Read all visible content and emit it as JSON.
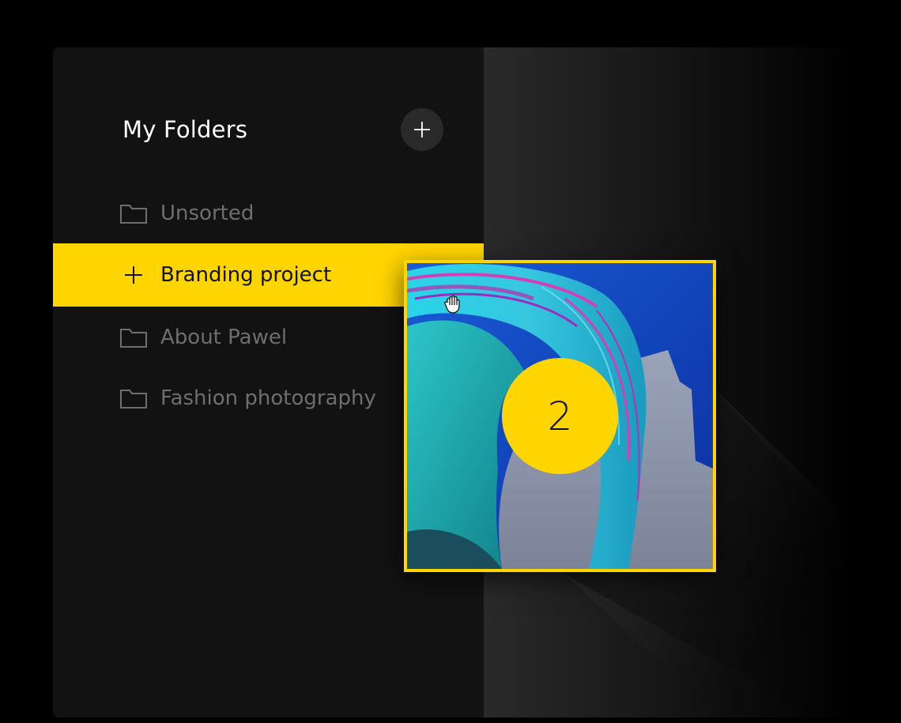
{
  "sidebar": {
    "title": "My Folders",
    "add_button_icon": "plus-icon",
    "folders": [
      {
        "label": "Unsorted",
        "icon": "folder-icon",
        "active": false
      },
      {
        "label": "Branding project",
        "icon": "plus-icon",
        "active": true
      },
      {
        "label": "About Pawel",
        "icon": "folder-icon",
        "active": false
      },
      {
        "label": "Fashion photography",
        "icon": "folder-icon",
        "active": false
      }
    ]
  },
  "drag_card": {
    "count": "2",
    "cursor_icon": "grab-hand-icon"
  },
  "colors": {
    "accent": "#ffd500",
    "panel": "#121212",
    "muted_text": "#6e6e6e",
    "text": "#ffffff"
  }
}
